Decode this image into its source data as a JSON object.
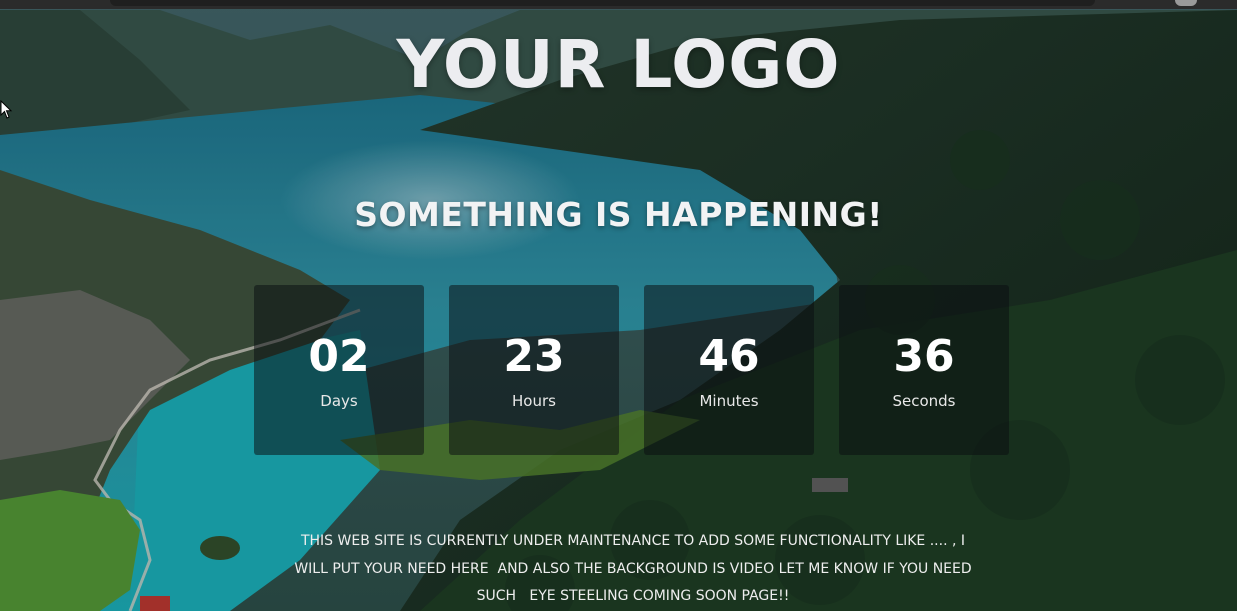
{
  "page": {
    "logo_text": "YOUR LOGO",
    "headline": "SOMETHING IS HAPPENING!",
    "background": "video-landscape-fjord"
  },
  "countdown": [
    {
      "value": "02",
      "label": "Days"
    },
    {
      "value": "23",
      "label": "Hours"
    },
    {
      "value": "46",
      "label": "Minutes"
    },
    {
      "value": "36",
      "label": "Seconds"
    }
  ],
  "notice": {
    "lines": [
      "THIS WEB SITE IS CURRENTLY UNDER MAINTENANCE TO ADD SOME FUNCTIONALITY LIKE .... , I",
      "WILL PUT YOUR NEED HERE  AND ALSO THE BACKGROUND IS VIDEO LET ME KNOW IF YOU NEED",
      "SUCH   EYE STEELING COMING SOON PAGE!!"
    ]
  },
  "colors": {
    "text": "#f2f3f4",
    "box_bg": "rgba(10,14,18,0.52)",
    "lake": "#1f9aa6",
    "forest": "#1e3a25"
  },
  "icons": {
    "cursor": "mouse-pointer-icon"
  }
}
